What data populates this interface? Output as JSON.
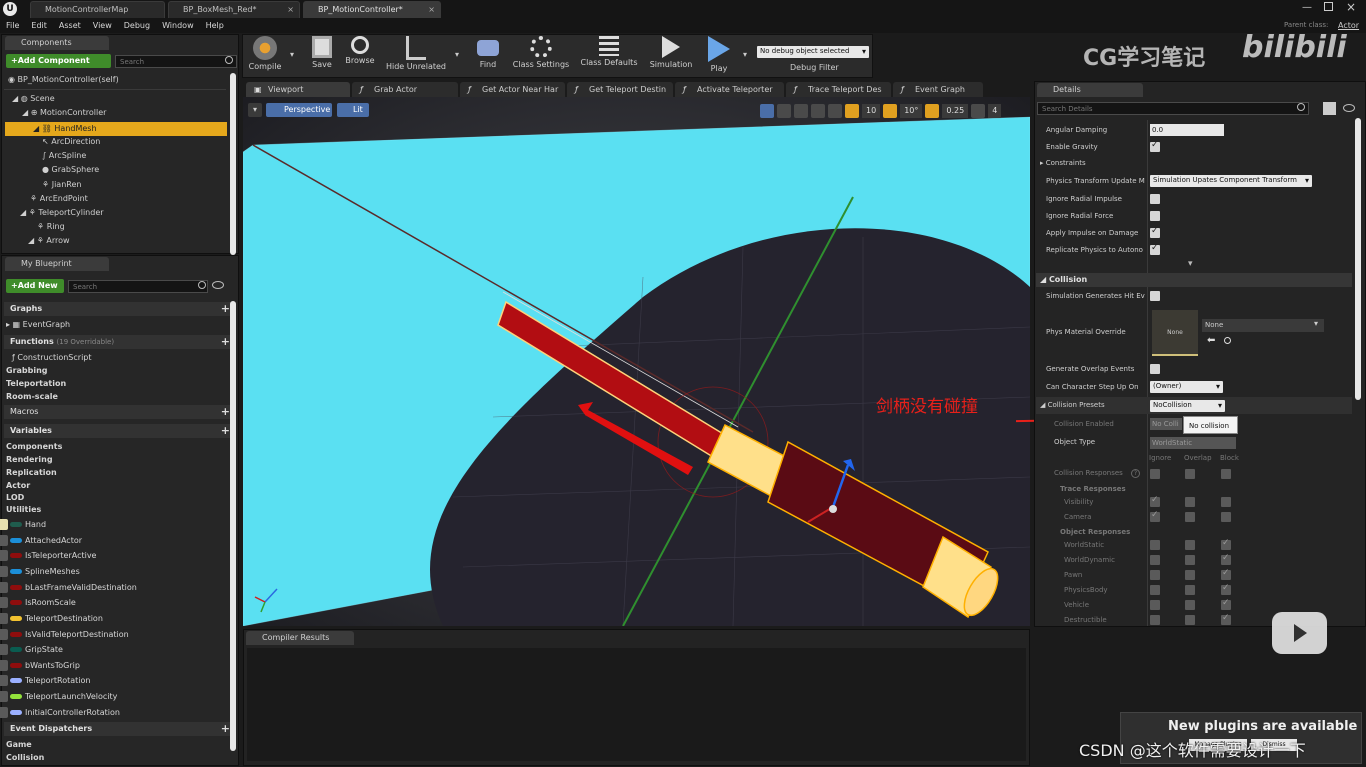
{
  "window": {
    "tabs": [
      "MotionControllerMap",
      "BP_BoxMesh_Red*",
      "BP_MotionController*"
    ],
    "parent_class_label": "Parent class:",
    "parent_class_value": "Actor"
  },
  "menu": [
    "File",
    "Edit",
    "Asset",
    "View",
    "Debug",
    "Window",
    "Help"
  ],
  "components": {
    "tab": "Components",
    "add_button": "+Add Component",
    "search_placeholder": "Search",
    "self_item": "BP_MotionController(self)",
    "tree": [
      "Scene",
      "MotionController",
      "HandMesh",
      "ArcDirection",
      "ArcSpline",
      "GrabSphere",
      "JianRen",
      "ArcEndPoint",
      "TeleportCylinder",
      "Ring",
      "Arrow"
    ]
  },
  "my_blueprint": {
    "tab": "My Blueprint",
    "add_button": "+Add New",
    "search_placeholder": "Search",
    "graphs_header": "Graphs",
    "event_graph": "EventGraph",
    "functions_header": "Functions",
    "functions_count": "(19 Overridable)",
    "construction_script": "ConstructionScript",
    "function_groups": [
      "Grabbing",
      "Teleportation",
      "Room-scale"
    ],
    "macros_header": "Macros",
    "variables_header": "Variables",
    "variable_groups": [
      "Components",
      "Rendering",
      "Replication",
      "Actor",
      "LOD",
      "Utilities"
    ],
    "variables": [
      {
        "name": "Hand",
        "color": "#1f5c4d"
      },
      {
        "name": "AttachedActor",
        "color": "#1c8fd8"
      },
      {
        "name": "IsTeleporterActive",
        "color": "#8f0d0d"
      },
      {
        "name": "SplineMeshes",
        "color": "#1c8fd8"
      },
      {
        "name": "bLastFrameValidDestination",
        "color": "#8f0d0d"
      },
      {
        "name": "IsRoomScale",
        "color": "#8f0d0d"
      },
      {
        "name": "TeleportDestination",
        "color": "#f2c230"
      },
      {
        "name": "IsValidTeleportDestination",
        "color": "#8f0d0d"
      },
      {
        "name": "GripState",
        "color": "#0a5c50"
      },
      {
        "name": "bWantsToGrip",
        "color": "#8f0d0d"
      },
      {
        "name": "TeleportRotation",
        "color": "#9bb0ff"
      },
      {
        "name": "TeleportLaunchVelocity",
        "color": "#93e23b"
      },
      {
        "name": "InitialControllerRotation",
        "color": "#9bb0ff"
      }
    ],
    "event_dispatchers_header": "Event Dispatchers",
    "dispatcher_groups": [
      "Game",
      "Collision"
    ]
  },
  "toolbar": {
    "compile": "Compile",
    "save": "Save",
    "browse": "Browse",
    "hide_unrelated": "Hide Unrelated",
    "find": "Find",
    "class_settings": "Class Settings",
    "class_defaults": "Class Defaults",
    "simulation": "Simulation",
    "play": "Play",
    "debug_object": "No debug object selected",
    "debug_filter": "Debug Filter"
  },
  "editor_tabs": [
    "Viewport",
    "Grab Actor",
    "Get Actor Near Har",
    "Get Teleport Destin",
    "Activate Teleporter",
    "Trace Teleport Des",
    "Event Graph"
  ],
  "viewport": {
    "perspective": "Perspective",
    "lit": "Lit",
    "grid_snap": "10",
    "rotation_snap": "10°",
    "scale_snap": "0.25",
    "camera_speed": "4",
    "annotation": "剑柄没有碰撞"
  },
  "compiler_results": {
    "tab": "Compiler Results"
  },
  "details": {
    "tab": "Details",
    "search_placeholder": "Search Details",
    "angular_damping_label": "Angular Damping",
    "angular_damping_value": "0.0",
    "enable_gravity": "Enable Gravity",
    "constraints": "Constraints",
    "physics_transform_update": "Physics Transform Update M",
    "physics_transform_value": "Simulation Upates Component Transform",
    "ignore_radial_impulse": "Ignore Radial Impulse",
    "ignore_radial_force": "Ignore Radial Force",
    "apply_impulse": "Apply Impulse on Damage",
    "replicate_physics": "Replicate Physics to Autono",
    "collision_header": "Collision",
    "sim_generates_hit": "Simulation Generates Hit Ev",
    "phys_material_override": "Phys Material Override",
    "phys_material_thumb": "None",
    "phys_material_value": "None",
    "generate_overlap": "Generate Overlap Events",
    "can_step_up": "Can Character Step Up On",
    "can_step_up_value": "(Owner)",
    "collision_presets": "Collision Presets",
    "collision_presets_value": "NoCollision",
    "tooltip": "No collision",
    "collision_enabled": "Collision Enabled",
    "collision_enabled_value": "No Colli",
    "object_type": "Object Type",
    "object_type_value": "WorldStatic",
    "col_headers": [
      "Ignore",
      "Overlap",
      "Block"
    ],
    "collision_responses": "Collision Responses",
    "trace_responses": "Trace Responses",
    "trace_items": [
      "Visibility",
      "Camera"
    ],
    "object_responses": "Object Responses",
    "object_items": [
      "WorldStatic",
      "WorldDynamic",
      "Pawn",
      "PhysicsBody",
      "Vehicle",
      "Destructible"
    ]
  },
  "overlay": {
    "watermark": "CG学习笔记",
    "bilibili": "bilibili",
    "plugins_notice": "New plugins are available",
    "csdn": "CSDN @这个软件需要设计一下",
    "manage": "Manage Plugins",
    "dismiss": "Dismiss"
  }
}
